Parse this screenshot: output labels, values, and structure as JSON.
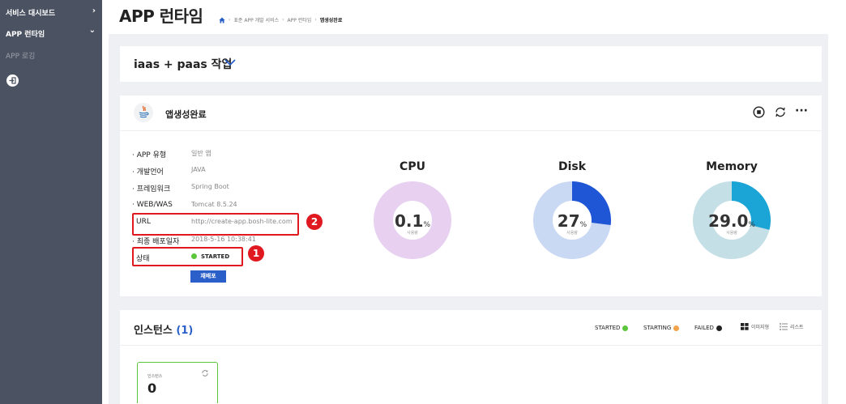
{
  "sidebar": {
    "items": [
      {
        "label": "서비스 대시보드",
        "chevron": "›"
      },
      {
        "label": "APP 런타임",
        "chevron": "⌄"
      },
      {
        "label": "APP 로깅"
      }
    ],
    "exit_icon": "exit-icon"
  },
  "header": {
    "title": "APP 런타임",
    "breadcrumb": [
      "표준 APP 개발 서비스",
      "APP 런타임",
      "앱생성완료"
    ],
    "breadcrumb_sep": "›"
  },
  "project": {
    "title": "iaas + paas 작업"
  },
  "app": {
    "name": "앱생성완료",
    "icon": "java-icon",
    "controls": [
      "stop-icon",
      "refresh-icon",
      "more-icon"
    ],
    "more_label": "···",
    "info": [
      {
        "key": "· APP 유형",
        "value": "일반 앱"
      },
      {
        "key": "· 개발언어",
        "value": "JAVA"
      },
      {
        "key": "· 프레임워크",
        "value": "Spring Boot"
      },
      {
        "key": "· WEB/WAS",
        "value": "Tomcat 8.5.24"
      },
      {
        "key": "URL",
        "value": "http://create-app.bosh-lite.com"
      },
      {
        "key": "· 최종 배포일자",
        "value": "2018-5-16 10:38:41"
      },
      {
        "key": "상태",
        "value": "STARTED"
      }
    ],
    "redeploy_label": "재배포",
    "markers": [
      "2",
      "1"
    ]
  },
  "gauges": [
    {
      "title": "CPU",
      "value": "0.1",
      "unit": "%",
      "sub": "사용량",
      "fraction": 0.001,
      "color": "#c45ad8",
      "track": "#e7d0f0"
    },
    {
      "title": "Disk",
      "value": "27",
      "unit": "%",
      "sub": "사용량",
      "fraction": 0.27,
      "color": "#1f56d6",
      "track": "#c9d8f3"
    },
    {
      "title": "Memory",
      "value": "29.0",
      "unit": "%",
      "sub": "사용량",
      "fraction": 0.29,
      "color": "#1ba4d6",
      "track": "#c4dfe6"
    }
  ],
  "instances": {
    "title": "인스턴스",
    "count": "(1)",
    "legend": [
      {
        "label": "STARTED",
        "color": "#5cc63a"
      },
      {
        "label": "STARTING",
        "color": "#f2a24a"
      },
      {
        "label": "FAILED",
        "color": "#222222"
      }
    ],
    "view_options": [
      "이미지형",
      "리스트"
    ],
    "card": {
      "label": "인스턴스",
      "number": "0",
      "status_color": "#5cc63a"
    }
  }
}
